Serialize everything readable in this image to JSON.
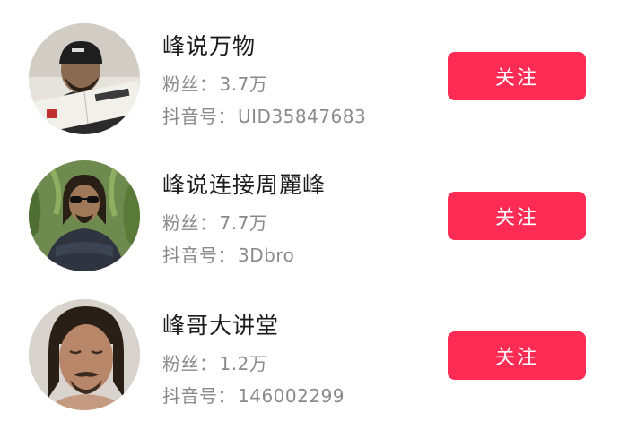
{
  "users": [
    {
      "name": "峰说万物",
      "fans_label": "粉丝：",
      "fans_value": "3.7万",
      "id_label": "抖音号：",
      "id_value": "UID35847683",
      "follow_label": "关注"
    },
    {
      "name": "峰说连接周麗峰",
      "fans_label": "粉丝：",
      "fans_value": "7.7万",
      "id_label": "抖音号：",
      "id_value": "3Dbro",
      "follow_label": "关注"
    },
    {
      "name": "峰哥大讲堂",
      "fans_label": "粉丝：",
      "fans_value": "1.2万",
      "id_label": "抖音号：",
      "id_value": "146002299",
      "follow_label": "关注"
    }
  ],
  "colors": {
    "follow_button": "#fe2c55",
    "name_text": "#1a1a1a",
    "meta_text": "#8a8a8a"
  }
}
